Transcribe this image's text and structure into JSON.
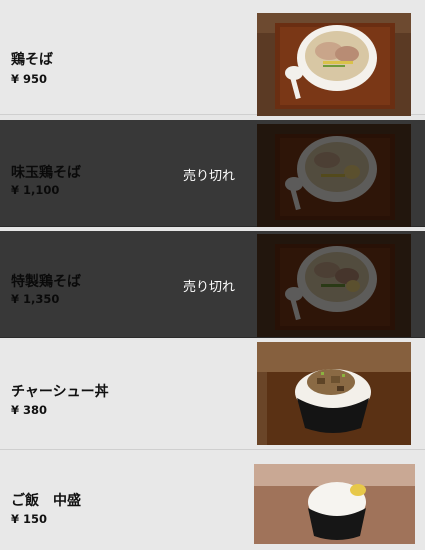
{
  "menu": {
    "items": [
      {
        "name": "鶏そば",
        "price": "¥ 950",
        "sold_out": false,
        "image_icon": "ramen-bowl-photo"
      },
      {
        "name": "味玉鶏そば",
        "price": "¥ 1,100",
        "sold_out": true,
        "sold_out_label": "売り切れ",
        "image_icon": "ramen-bowl-photo"
      },
      {
        "name": "特製鶏そば",
        "price": "¥ 1,350",
        "sold_out": true,
        "sold_out_label": "売り切れ",
        "image_icon": "ramen-bowl-photo"
      },
      {
        "name": "チャーシュー丼",
        "price": "¥ 380",
        "sold_out": false,
        "image_icon": "chashu-rice-bowl-photo"
      },
      {
        "name": "ご飯　中盛",
        "price": "¥ 150",
        "sold_out": false,
        "image_icon": "rice-bowl-photo"
      }
    ]
  },
  "colors": {
    "row_background": "#e8e8e8",
    "sold_out_background": "#383838",
    "sold_out_text": "#ffffff"
  }
}
